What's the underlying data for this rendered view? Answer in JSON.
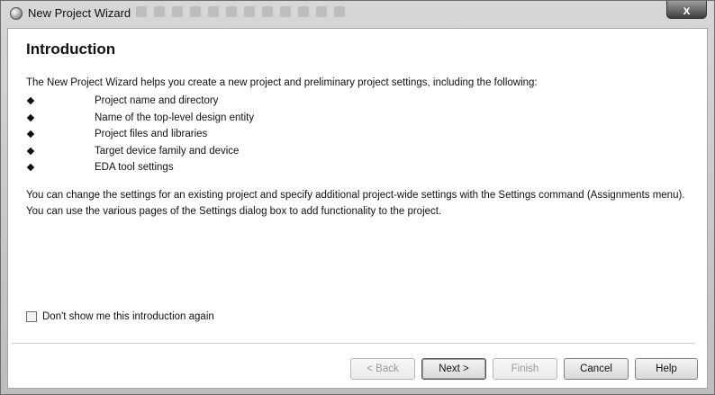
{
  "window": {
    "title": "New Project Wizard",
    "close_label": "x"
  },
  "content": {
    "heading": "Introduction",
    "intro": "The New Project Wizard helps you create a new project and preliminary project settings, including the following:",
    "bullets": [
      "Project name and directory",
      "Name of the top-level design entity",
      "Project files and libraries",
      "Target device family and device",
      "EDA tool settings"
    ],
    "paragraph": "You can change the settings for an existing project and specify additional project-wide settings with the Settings command (Assignments menu). You can use the various pages of the Settings dialog box to add functionality to the project."
  },
  "checkbox": {
    "label": "Don't show me this introduction again",
    "checked": false
  },
  "buttons": {
    "back": "< Back",
    "next": "Next >",
    "finish": "Finish",
    "cancel": "Cancel",
    "help": "Help"
  }
}
